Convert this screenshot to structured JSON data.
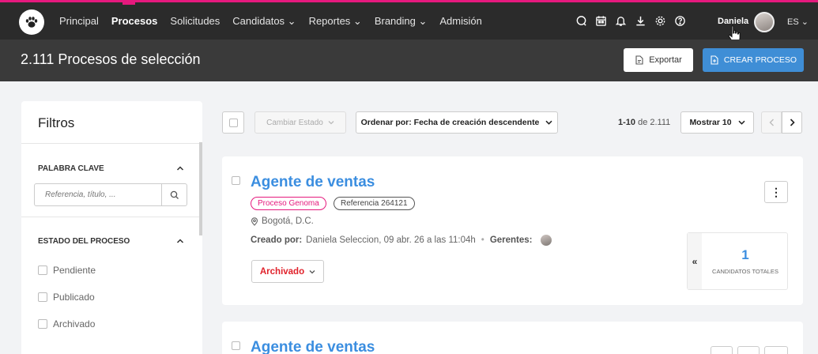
{
  "nav": {
    "items": [
      {
        "label": "Principal",
        "active": false
      },
      {
        "label": "Procesos",
        "active": true
      },
      {
        "label": "Solicitudes",
        "active": false
      },
      {
        "label": "Candidatos ⌄",
        "active": false
      },
      {
        "label": "Reportes ⌄",
        "active": false
      },
      {
        "label": "Branding ⌄",
        "active": false
      },
      {
        "label": "Admisión",
        "active": false
      }
    ],
    "icons": [
      "chat-icon",
      "calendar-icon",
      "bell-icon",
      "download-icon",
      "settings-icon",
      "help-icon"
    ],
    "user_name": "Daniela",
    "language": "ES ⌄"
  },
  "header": {
    "title": "2.111 Procesos de selección",
    "export_label": "Exportar",
    "create_label": "CREAR PROCESO"
  },
  "filters": {
    "title": "Filtros",
    "keyword_label": "PALABRA CLAVE",
    "keyword_placeholder": "Referencia, título, ...",
    "state_label": "ESTADO DEL PROCESO",
    "states": [
      "Pendiente",
      "Publicado",
      "Archivado"
    ]
  },
  "toolbar": {
    "change_state_label": "Cambiar Estado",
    "order_label": "Ordenar por: Fecha de creación descendente",
    "range": "1-10",
    "range_of": "de 2.111",
    "show_label": "Mostrar 10"
  },
  "jobs": [
    {
      "title": "Agente de ventas",
      "tag_primary": "Proceso Genoma",
      "tag_reference": "Referencia 264121",
      "location": "Bogotá, D.C.",
      "created_by_label": "Creado por:",
      "created_by_value": "Daniela Seleccion, 09 abr. 26 a las 11:04h",
      "managers_label": "Gerentes:",
      "status": "Archivado",
      "candidates": "1",
      "candidates_label": "CANDIDATOS TOTALES",
      "collapse_symbol": "«",
      "kebab_symbol": "⋮"
    },
    {
      "title": "Agente de ventas"
    }
  ],
  "colors": {
    "accent_pink": "#e5197d",
    "primary_blue": "#3f8ed6",
    "title_blue": "#3b8ee0",
    "status_red": "#e0222b",
    "topbar_dark": "#2b2b2b"
  }
}
